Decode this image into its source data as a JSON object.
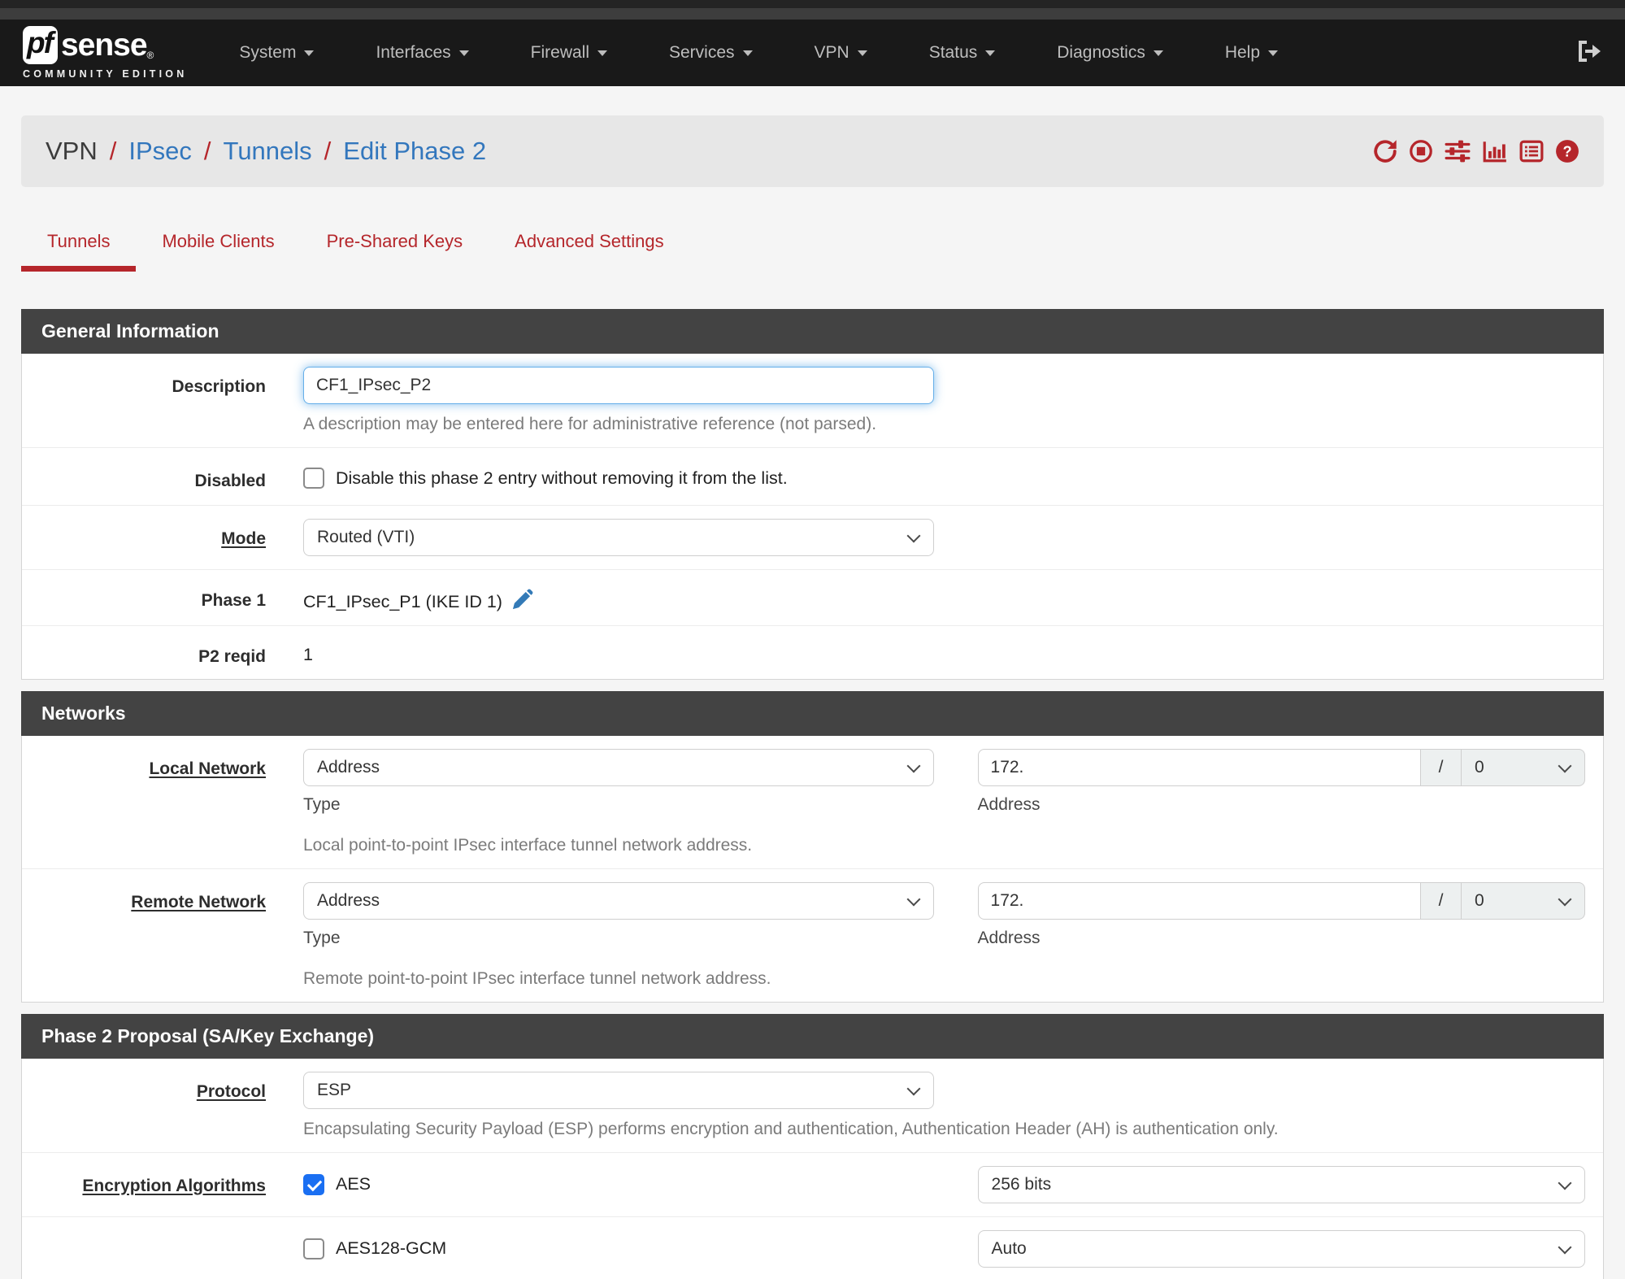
{
  "colors": {
    "accent_red": "#b5262b",
    "link_blue": "#3377bd",
    "panel_header_gray": "#434343",
    "checkbox_blue": "#1a6ff2",
    "navbar_black": "#191919"
  },
  "navbar": {
    "logo_pf": "pf",
    "logo_sense": "sense",
    "logo_reg": "®",
    "logo_edition": "COMMUNITY EDITION",
    "items": [
      {
        "label": "System"
      },
      {
        "label": "Interfaces"
      },
      {
        "label": "Firewall"
      },
      {
        "label": "Services"
      },
      {
        "label": "VPN"
      },
      {
        "label": "Status"
      },
      {
        "label": "Diagnostics"
      },
      {
        "label": "Help"
      }
    ]
  },
  "breadcrumb": {
    "root": "VPN",
    "sep": "/",
    "links": [
      "IPsec",
      "Tunnels",
      "Edit Phase 2"
    ],
    "icons": [
      "refresh",
      "stop-circle",
      "sliders",
      "bar-chart",
      "list",
      "question-circle"
    ]
  },
  "tabs": [
    {
      "label": "Tunnels",
      "active": true
    },
    {
      "label": "Mobile Clients",
      "active": false
    },
    {
      "label": "Pre-Shared Keys",
      "active": false
    },
    {
      "label": "Advanced Settings",
      "active": false
    }
  ],
  "general": {
    "title": "General Information",
    "description": {
      "label": "Description",
      "value": "CF1_IPsec_P2",
      "help": "A description may be entered here for administrative reference (not parsed)."
    },
    "disabled": {
      "label": "Disabled",
      "checkbox_label": "Disable this phase 2 entry without removing it from the list.",
      "checked": false
    },
    "mode": {
      "label": "Mode",
      "value": "Routed (VTI)"
    },
    "phase1": {
      "label": "Phase 1",
      "value": "CF1_IPsec_P1 (IKE ID 1)"
    },
    "p2reqid": {
      "label": "P2 reqid",
      "value": "1"
    }
  },
  "networks": {
    "title": "Networks",
    "local": {
      "label": "Local Network",
      "type_value": "Address",
      "type_caption": "Type",
      "address_value": "172.",
      "slash": "/",
      "prefix_value": "0",
      "address_caption": "Address",
      "help": "Local point-to-point IPsec interface tunnel network address."
    },
    "remote": {
      "label": "Remote Network",
      "type_value": "Address",
      "type_caption": "Type",
      "address_value": "172.",
      "slash": "/",
      "prefix_value": "0",
      "address_caption": "Address",
      "help": "Remote point-to-point IPsec interface tunnel network address."
    }
  },
  "proposal": {
    "title": "Phase 2 Proposal (SA/Key Exchange)",
    "protocol": {
      "label": "Protocol",
      "value": "ESP",
      "help": "Encapsulating Security Payload (ESP) performs encryption and authentication, Authentication Header (AH) is authentication only."
    },
    "encryption": {
      "label": "Encryption Algorithms",
      "options": [
        {
          "name": "AES",
          "checked": true,
          "keylen": "256 bits"
        },
        {
          "name": "AES128-GCM",
          "checked": false,
          "keylen": "Auto"
        }
      ]
    }
  }
}
